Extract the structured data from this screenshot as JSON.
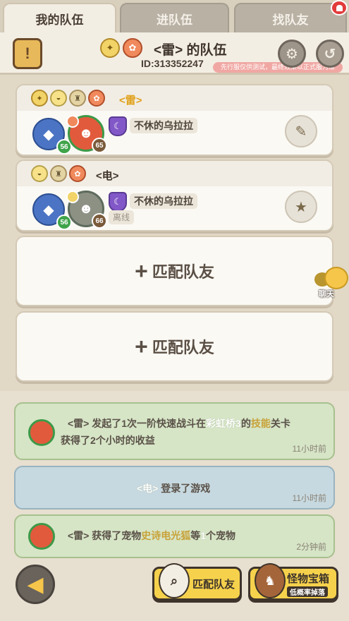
{
  "tabs": [
    {
      "label": "我的队伍",
      "active": true
    },
    {
      "label": "进队伍",
      "active": false
    },
    {
      "label": "找队友",
      "active": false
    }
  ],
  "header": {
    "team_title": "˂雷˃ 的队伍",
    "team_id": "ID:313352247",
    "promo": "先行服仅供测试，最终效果以正式服为准"
  },
  "members": [
    {
      "name": "˂雷˃",
      "pet_level": "56",
      "hero_level": "65",
      "guild": "不休的乌拉拉",
      "status": ""
    },
    {
      "name": "˂电˃",
      "pet_level": "56",
      "hero_level": "66",
      "guild": "不休的乌拉拉",
      "status": "离线"
    }
  ],
  "match_slots": [
    "匹配队友",
    "匹配队友"
  ],
  "chat_label": "聊天",
  "logs": [
    {
      "line1_a": "˂雷˃ 发起了1次一阶快速战斗在",
      "line1_b": "彩虹桥3",
      "line1_c": "的",
      "line1_d": "技能",
      "line1_e": "关卡",
      "line2": "获得了2个小时的收益",
      "time": "11小时前"
    },
    {
      "text_a": "˂电˃",
      "text_b": " 登录了游戏",
      "time": "11小时前"
    },
    {
      "text_a": "˂雷˃ 获得了宠物",
      "text_b": "史诗电光狐",
      "text_c": "等",
      "text_d": "1",
      "text_e": "个宠物",
      "time": "2分钟前"
    }
  ],
  "bottom": {
    "match_label": "匹配队友",
    "chest_label": "怪物宝箱",
    "chest_sub": "低概率掉落"
  }
}
